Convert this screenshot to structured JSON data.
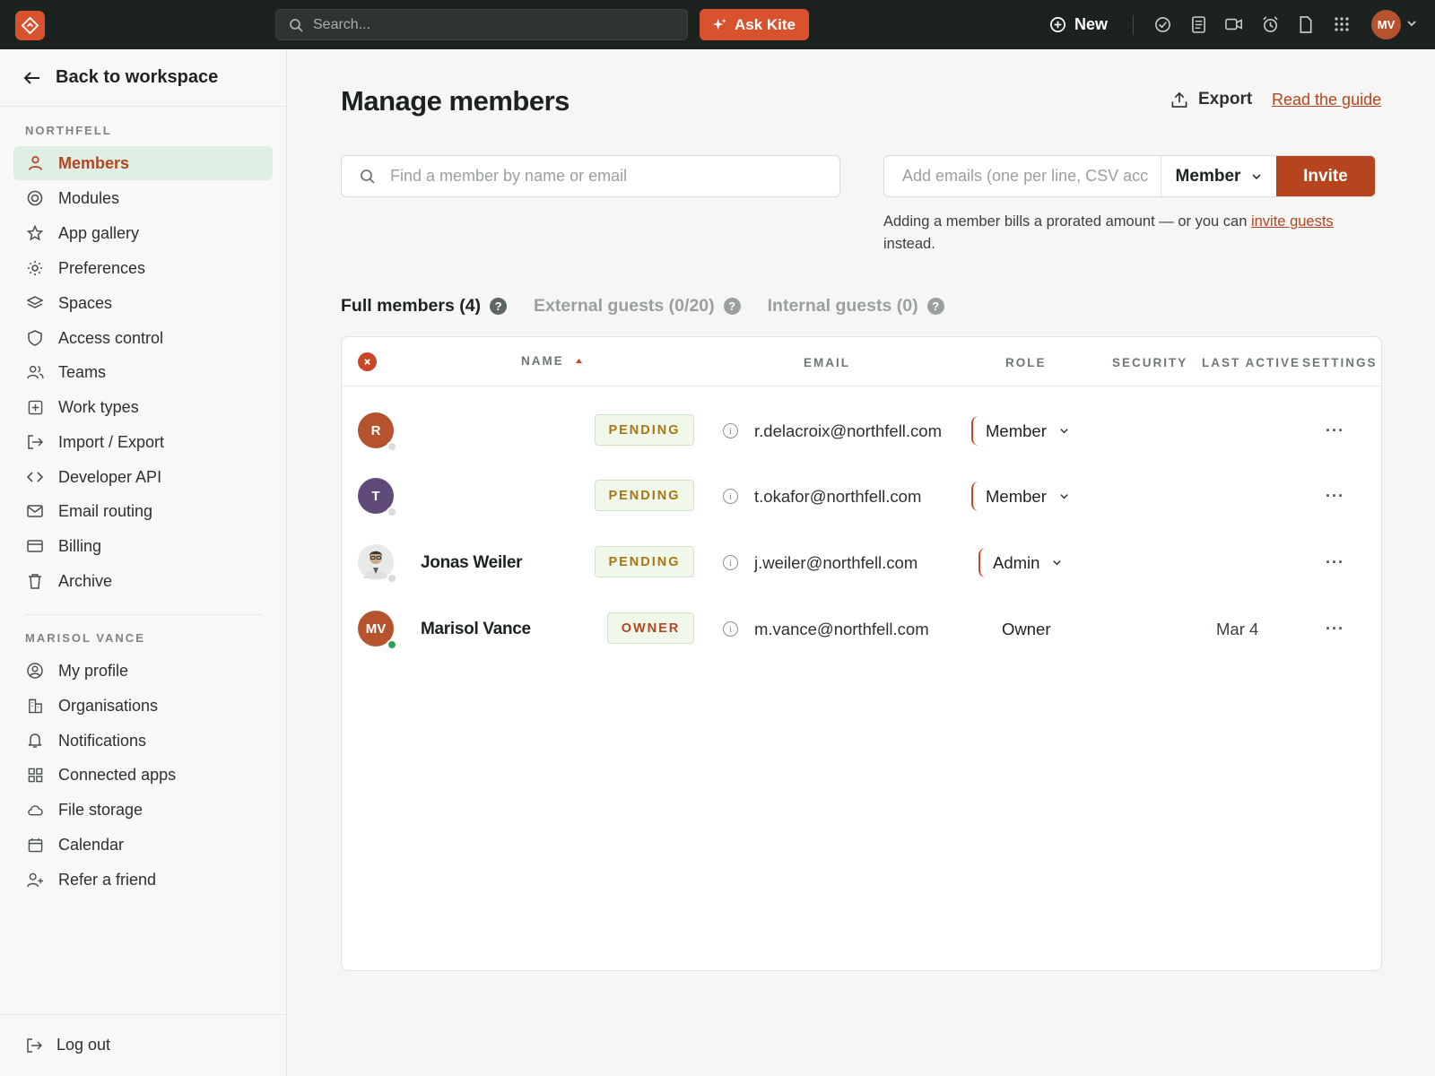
{
  "topbar": {
    "search_placeholder": "Search...",
    "ask_label": "Ask Kite",
    "new_label": "New",
    "avatar_initials": "MV"
  },
  "sidebar": {
    "back_label": "Back to workspace",
    "workspace_section": "NORTHFELL",
    "workspace_items": [
      {
        "label": "Members",
        "icon": "person-icon",
        "active": true
      },
      {
        "label": "Modules",
        "icon": "target-icon"
      },
      {
        "label": "App gallery",
        "icon": "star-icon"
      },
      {
        "label": "Preferences",
        "icon": "sun-icon"
      },
      {
        "label": "Spaces",
        "icon": "layers-icon"
      },
      {
        "label": "Access control",
        "icon": "shield-icon"
      },
      {
        "label": "Teams",
        "icon": "team-icon"
      },
      {
        "label": "Work types",
        "icon": "plus-square-icon"
      },
      {
        "label": "Import / Export",
        "icon": "import-icon"
      },
      {
        "label": "Developer API",
        "icon": "code-icon"
      },
      {
        "label": "Email routing",
        "icon": "mail-icon"
      },
      {
        "label": "Billing",
        "icon": "card-icon"
      },
      {
        "label": "Archive",
        "icon": "trash-icon"
      }
    ],
    "user_section": "MARISOL VANCE",
    "user_items": [
      {
        "label": "My profile",
        "icon": "user-circle-icon"
      },
      {
        "label": "Organisations",
        "icon": "building-icon"
      },
      {
        "label": "Notifications",
        "icon": "bell-icon"
      },
      {
        "label": "Connected apps",
        "icon": "grid-icon"
      },
      {
        "label": "File storage",
        "icon": "cloud-icon"
      },
      {
        "label": "Calendar",
        "icon": "calendar-icon"
      },
      {
        "label": "Refer a friend",
        "icon": "user-plus-icon"
      }
    ],
    "logout_label": "Log out"
  },
  "main": {
    "title": "Manage members",
    "export_label": "Export",
    "guide_label": "Read the guide",
    "member_search_placeholder": "Find a member by name or email",
    "invite_placeholder": "Add emails (one per line, CSV acc",
    "invite_role": "Member",
    "invite_button": "Invite",
    "invite_note_prefix": "Adding a member bills a prorated amount — or you can ",
    "invite_note_link": "invite guests",
    "invite_note_suffix": " instead.",
    "tabs": [
      {
        "label": "Full members (4)",
        "active": true
      },
      {
        "label": "External guests (0/20)"
      },
      {
        "label": "Internal guests (0)"
      }
    ],
    "columns": {
      "name": "NAME",
      "email": "EMAIL",
      "role": "ROLE",
      "security": "SECURITY",
      "last_active": "LAST ACTIVE",
      "settings": "SETTINGS"
    },
    "rows": [
      {
        "initials": "R",
        "name": "",
        "badge": "PENDING",
        "email": "r.delacroix@northfell.com",
        "role": "Member",
        "last_active": ""
      },
      {
        "initials": "T",
        "name": "",
        "badge": "PENDING",
        "email": "t.okafor@northfell.com",
        "role": "Member",
        "last_active": ""
      },
      {
        "initials": "",
        "name": "Jonas Weiler",
        "badge": "PENDING",
        "email": "j.weiler@northfell.com",
        "role": "Admin",
        "last_active": ""
      },
      {
        "initials": "MV",
        "name": "Marisol Vance",
        "badge": "OWNER",
        "email": "m.vance@northfell.com",
        "role": "Owner",
        "last_active": "Mar 4"
      }
    ],
    "more_label": "···"
  },
  "colors": {
    "accent": "#b5441f",
    "accent_bright": "#d9522e",
    "topbar": "#1c221f",
    "active_nav_bg": "#dfefe4"
  }
}
